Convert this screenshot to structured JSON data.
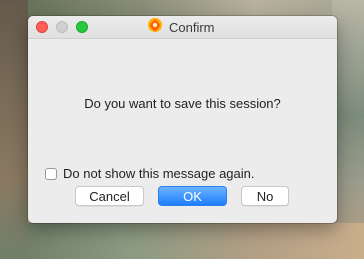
{
  "window": {
    "title": "Confirm",
    "app_icon": "xnview-flame-icon"
  },
  "dialog": {
    "message": "Do you want to save this session?",
    "checkbox_label": "Do not show this message again.",
    "checkbox_checked": false
  },
  "buttons": {
    "cancel_label": "Cancel",
    "ok_label": "OK",
    "no_label": "No"
  },
  "colors": {
    "primary_button": "#1d7eff",
    "close_button": "#ff5f57",
    "maximize_button": "#28c840"
  }
}
